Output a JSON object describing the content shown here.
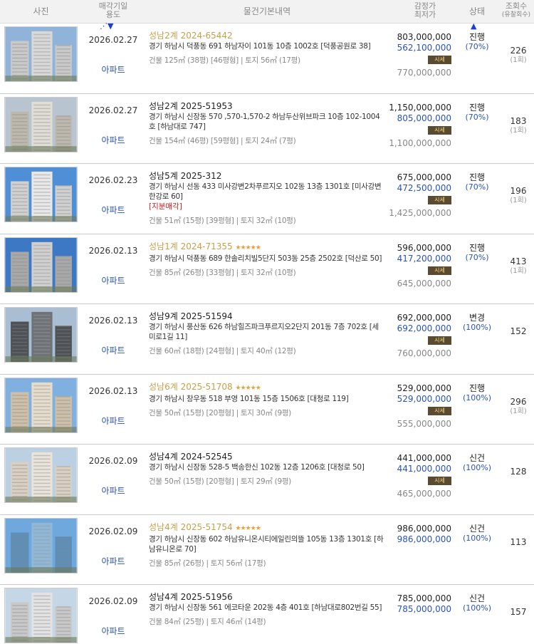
{
  "header": {
    "photo": "사진",
    "date": "매각기일",
    "usage": "용도",
    "desc": "물건기본내역",
    "appraisal": "감정가",
    "min_price": "최저가",
    "status": "상태",
    "views": "조회수",
    "views_sub": "(유찰회수)"
  },
  "rows": [
    {
      "date": "2026.02.27",
      "usage": "아파트",
      "case": "성남2계 2024-65442",
      "highlight": true,
      "stars": "",
      "address": "경기 하남시 덕풍동 691 하남자이 101동 10층 1002호 [덕풍공원로 38]",
      "note": "",
      "area": "건물 125㎡ (38평) [46평형]  |  토지 56㎡ (17평)",
      "appraisal": "803,000,000",
      "min_price": "562,100,000",
      "badge": "시세",
      "last_price": "770,000,000",
      "status": "진행",
      "percent": "(70%)",
      "views": "226",
      "fails": "(1회)",
      "theme": "a"
    },
    {
      "date": "2026.02.27",
      "usage": "아파트",
      "case": "성남2계 2025-51953",
      "highlight": false,
      "stars": "",
      "address": "경기 하남시 신장동 570 ,570-1,570-2 하남두산위브파크 10층 102-1004호 [하남대로 747]",
      "note": "",
      "area": "건물 154㎡ (46평) [59평형]  |  토지 24㎡ (7평)",
      "appraisal": "1,150,000,000",
      "min_price": "805,000,000",
      "badge": "시세",
      "last_price": "1,100,000,000",
      "status": "진행",
      "percent": "(70%)",
      "views": "183",
      "fails": "(1회)",
      "theme": "b"
    },
    {
      "date": "2026.02.23",
      "usage": "아파트",
      "case": "성남5계 2025-312",
      "highlight": false,
      "stars": "",
      "address": "경기 하남시 선동 433 미사강변2차푸르지오 102동 13층 1301호 [미사강변한강로 60]",
      "note": "[지분매각]",
      "area": "건물 51㎡ (15평) [39평형]  |  토지 32㎡ (10평)",
      "appraisal": "675,000,000",
      "min_price": "472,500,000",
      "badge": "시세",
      "last_price": "1,425,000,000",
      "status": "진행",
      "percent": "(70%)",
      "views": "196",
      "fails": "(1회)",
      "theme": "c"
    },
    {
      "date": "2026.02.13",
      "usage": "아파트",
      "case": "성남1계 2024-71355",
      "highlight": true,
      "stars": "★★★★★",
      "address": "경기 하남시 덕풍동 689 한솔리치빌5단지 503동 25층 2502호 [덕산로 50]",
      "note": "",
      "area": "건물 85㎡ (26평) [33평형]  |  토지 32㎡ (10평)",
      "appraisal": "596,000,000",
      "min_price": "417,200,000",
      "badge": "시세",
      "last_price": "645,000,000",
      "status": "진행",
      "percent": "(70%)",
      "views": "413",
      "fails": "(1회)",
      "theme": "d"
    },
    {
      "date": "2026.02.13",
      "usage": "아파트",
      "case": "성남9계 2025-51594",
      "highlight": false,
      "stars": "",
      "address": "경기 하남시 풍산동 626 하남힐즈파크푸르지오2단지 201동 7층 702호 [세미로1길 11]",
      "note": "",
      "area": "건물 60㎡ (18평) [24평형]  |  토지 40㎡ (12평)",
      "appraisal": "692,000,000",
      "min_price": "692,000,000",
      "badge": "시세",
      "last_price": "760,000,000",
      "status": "변경",
      "percent": "(100%)",
      "views": "152",
      "fails": "",
      "theme": "e"
    },
    {
      "date": "2026.02.13",
      "usage": "아파트",
      "case": "성남6계 2025-51708",
      "highlight": true,
      "stars": "★★★★★",
      "address": "경기 하남시 창우동 518 부영 101동 15층 1506호 [대청로 119]",
      "note": "",
      "area": "건물 50㎡ (15평) [20평형]  |  토지 30㎡ (9평)",
      "appraisal": "529,000,000",
      "min_price": "529,000,000",
      "badge": "시세",
      "last_price": "555,000,000",
      "status": "진행",
      "percent": "(100%)",
      "views": "296",
      "fails": "(1회)",
      "theme": "f"
    },
    {
      "date": "2026.02.09",
      "usage": "아파트",
      "case": "성남4계 2024-52545",
      "highlight": false,
      "stars": "",
      "address": "경기 하남시 신장동 528-5 백송한신 102동 12층 1206호 [대청로 50]",
      "note": "",
      "area": "건물 50㎡ (15평) [20평형]  |  토지 29㎡ (9평)",
      "appraisal": "441,000,000",
      "min_price": "441,000,000",
      "badge": "시세",
      "last_price": "465,000,000",
      "status": "신건",
      "percent": "(100%)",
      "views": "128",
      "fails": "",
      "theme": "g"
    },
    {
      "date": "2026.02.09",
      "usage": "아파트",
      "case": "성남4계 2025-51754",
      "highlight": true,
      "stars": "★★★★★",
      "address": "경기 하남시 신장동 602 하남유니온시티에일린의뜰 105동 13층 1301호 [하남유니온로 70]",
      "note": "",
      "area": "건물 85㎡ (26평)  |  토지 56㎡ (17평)",
      "appraisal": "986,000,000",
      "min_price": "986,000,000",
      "badge": "",
      "last_price": "",
      "status": "신건",
      "percent": "(100%)",
      "views": "113",
      "fails": "",
      "theme": "h"
    },
    {
      "date": "2026.02.09",
      "usage": "아파트",
      "case": "성남4계 2025-51956",
      "highlight": false,
      "stars": "",
      "address": "경기 하남시 신장동 561 에코타운 202동 4층 401호 [하남대로802번길 55]",
      "note": "",
      "area": "건물 84㎡ (25평)  |  토지 46㎡ (14평)",
      "appraisal": "785,000,000",
      "min_price": "785,000,000",
      "badge": "",
      "last_price": "",
      "status": "신건",
      "percent": "(100%)",
      "views": "157",
      "fails": "",
      "theme": "i"
    }
  ]
}
